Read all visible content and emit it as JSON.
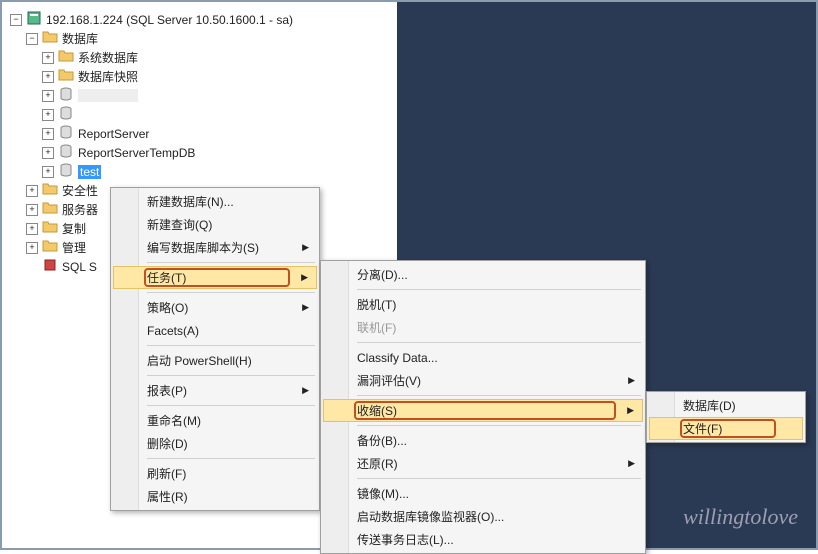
{
  "tree": {
    "server_label": "192.168.1.224 (SQL Server 10.50.1600.1 - sa)",
    "databases_label": "数据库",
    "sys_db_label": "系统数据库",
    "snap_label": "数据库快照",
    "blank_db_label": "",
    "report_server_label": "ReportServer",
    "report_server_temp_label": "ReportServerTempDB",
    "test_label": "test",
    "security_label": "安全性",
    "server_objects_label": "服务器",
    "replication_label": "复制",
    "management_label": "管理",
    "sql_agent_label": "SQL S"
  },
  "menu1": {
    "new_db": "新建数据库(N)...",
    "new_query": "新建查询(Q)",
    "script_db": "编写数据库脚本为(S)",
    "tasks": "任务(T)",
    "policies": "策略(O)",
    "facets": "Facets(A)",
    "powershell": "启动 PowerShell(H)",
    "reports": "报表(P)",
    "rename": "重命名(M)",
    "delete": "删除(D)",
    "refresh": "刷新(F)",
    "properties": "属性(R)"
  },
  "menu2": {
    "detach": "分离(D)...",
    "offline": "脱机(T)",
    "online": "联机(F)",
    "classify": "Classify Data...",
    "vuln": "漏洞评估(V)",
    "shrink": "收缩(S)",
    "backup": "备份(B)...",
    "restore": "还原(R)",
    "mirror": "镜像(M)...",
    "mirror_mon": "启动数据库镜像监视器(O)...",
    "ship_log": "传送事务日志(L)..."
  },
  "menu3": {
    "database": "数据库(D)",
    "file": "文件(F)"
  },
  "watermark": "willingtolove"
}
